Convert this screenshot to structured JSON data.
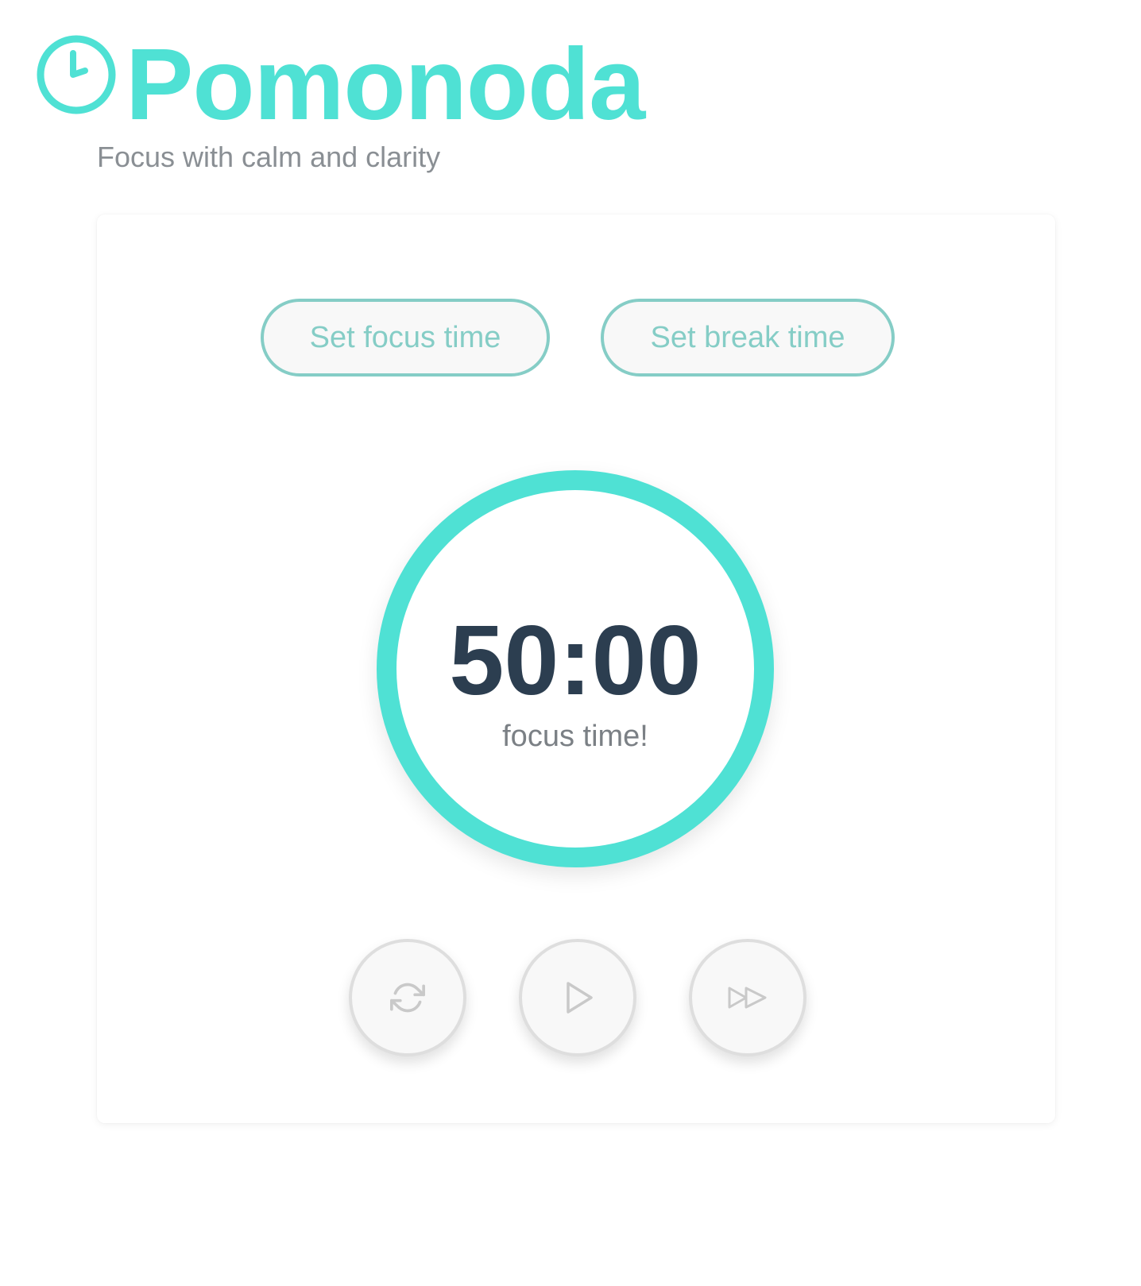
{
  "header": {
    "title": "Pomonoda",
    "tagline": "Focus with calm and clarity",
    "logo_icon": "clock-icon"
  },
  "modes": {
    "focus_label": "Set focus time",
    "break_label": "Set break time"
  },
  "timer": {
    "time": "50:00",
    "status": "focus time!"
  },
  "controls": {
    "reset_icon": "refresh-icon",
    "play_icon": "play-icon",
    "skip_icon": "fast-forward-icon"
  },
  "colors": {
    "accent": "#4fe1d4",
    "button_outline": "#85cdc6",
    "timer_text": "#2c3e50",
    "muted_text": "#8a8f94",
    "control_icon": "#c9c9c9"
  }
}
